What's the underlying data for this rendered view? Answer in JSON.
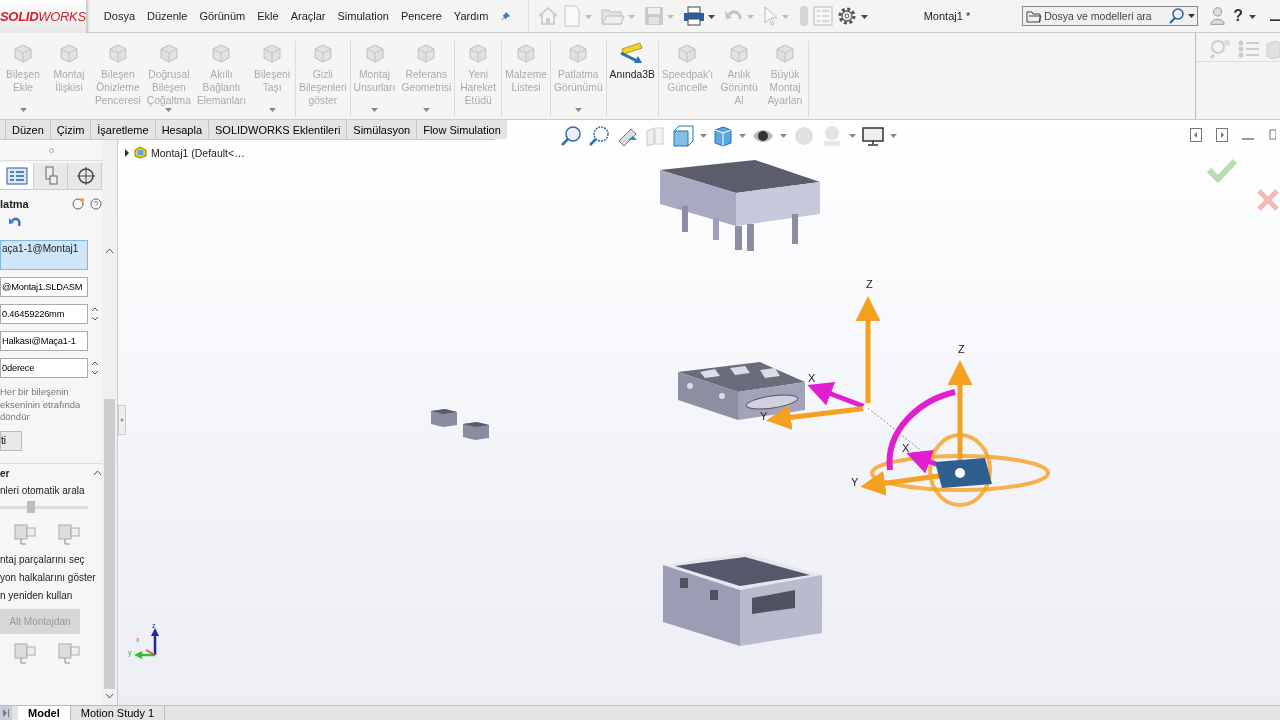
{
  "menu_bar": {
    "logo": "**SOLID**WORKS",
    "menus": [
      "Dosya",
      "Düzenle",
      "Görünüm",
      "Ekle",
      "Araçlar",
      "Simulation",
      "Pencere",
      "Yardım"
    ],
    "document_title": "Montaj1 *",
    "search": {
      "placeholder": "Dosya ve modelleri ara"
    },
    "help": "?"
  },
  "ribbon": {
    "groups": [
      {
        "items": [
          {
            "label": "Bileşen\nEkle",
            "disabled": true,
            "dropdown": true
          },
          {
            "label": "Montaj\nİlişkisi",
            "disabled": true,
            "dropdown": false
          },
          {
            "label": "Bileşen\nÖnizleme\nPenceresi",
            "disabled": true,
            "dropdown": false
          },
          {
            "label": "Doğrusal\nBileşen\nÇoğaltma",
            "disabled": true,
            "dropdown": true
          },
          {
            "label": "Akıllı\nBağlantı\nElemanları",
            "disabled": true,
            "dropdown": false
          },
          {
            "label": "Bileşeni\nTaşı",
            "disabled": true,
            "dropdown": true
          }
        ]
      },
      {
        "items": [
          {
            "label": "Gizli\nBileşenleri\ngöster",
            "disabled": true,
            "dropdown": false
          }
        ]
      },
      {
        "items": [
          {
            "label": "Montaj\nUnsurları",
            "disabled": true,
            "dropdown": true
          },
          {
            "label": "Referans\nGeometrisi",
            "disabled": true,
            "dropdown": true
          }
        ]
      },
      {
        "items": [
          {
            "label": "Yeni\nHareket\nEtüdü",
            "disabled": true,
            "dropdown": false
          }
        ]
      },
      {
        "items": [
          {
            "label": "Malzeme\nListesi",
            "disabled": true,
            "dropdown": false
          }
        ]
      },
      {
        "items": [
          {
            "label": "Patlatma\nGörünümü",
            "disabled": true,
            "dropdown": true
          }
        ]
      },
      {
        "items": [
          {
            "label": "Anında3B",
            "disabled": false,
            "dropdown": false
          }
        ]
      },
      {
        "items": [
          {
            "label": "Speedpak'ı\nGüncelle",
            "disabled": true,
            "dropdown": false
          },
          {
            "label": "Anlık\nGörüntü\nAl",
            "disabled": true,
            "dropdown": false
          },
          {
            "label": "Büyük\nMontaj\nAyarları",
            "disabled": true,
            "dropdown": false
          }
        ]
      }
    ]
  },
  "command_tabs": [
    {
      "label": "Düzen",
      "selected": false
    },
    {
      "label": "Çizim",
      "selected": false
    },
    {
      "label": "İşaretleme",
      "selected": false
    },
    {
      "label": "Hesapla",
      "selected": false
    },
    {
      "label": "SOLIDWORKS Eklentileri",
      "selected": false
    },
    {
      "label": "Simülasyon",
      "selected": false
    },
    {
      "label": "Flow Simulation",
      "selected": false
    }
  ],
  "property_manager": {
    "title": "latma",
    "selection_list": "aça1-1@Montaj1",
    "fields": [
      {
        "value": "@Montaj1.SLDASM",
        "kind": "text"
      },
      {
        "value": "0.46459226mm",
        "kind": "spinner"
      },
      {
        "value": "Halkası@Maça1-1",
        "kind": "text"
      },
      {
        "value": "0derece",
        "kind": "spinner"
      }
    ],
    "note": "Her bir bileşenin\nekseninin etrafında\ndöndür",
    "button": "ti",
    "section": {
      "title": "er",
      "expanded": true
    },
    "auto_space": "nleri otomatik arala",
    "slider": {
      "level": 0.35
    },
    "options": [
      "ntaj parçalarını seç",
      "yon halkalarını göster",
      "n yeniden kullan"
    ],
    "subassembly_button": {
      "label": "Alt Montajdan",
      "disabled": true
    }
  },
  "tree": {
    "root": "Montaj1  (Default<…",
    "expanded": false
  },
  "viewport": {
    "axis_labels": [
      "Z",
      "X",
      "Y",
      "Z",
      "X",
      "Y"
    ],
    "triad_labels": [
      "z",
      "x",
      "y"
    ]
  },
  "bottom_tabs": [
    {
      "label": "Model",
      "selected": true
    },
    {
      "label": "Motion Study 1",
      "selected": false
    }
  ]
}
